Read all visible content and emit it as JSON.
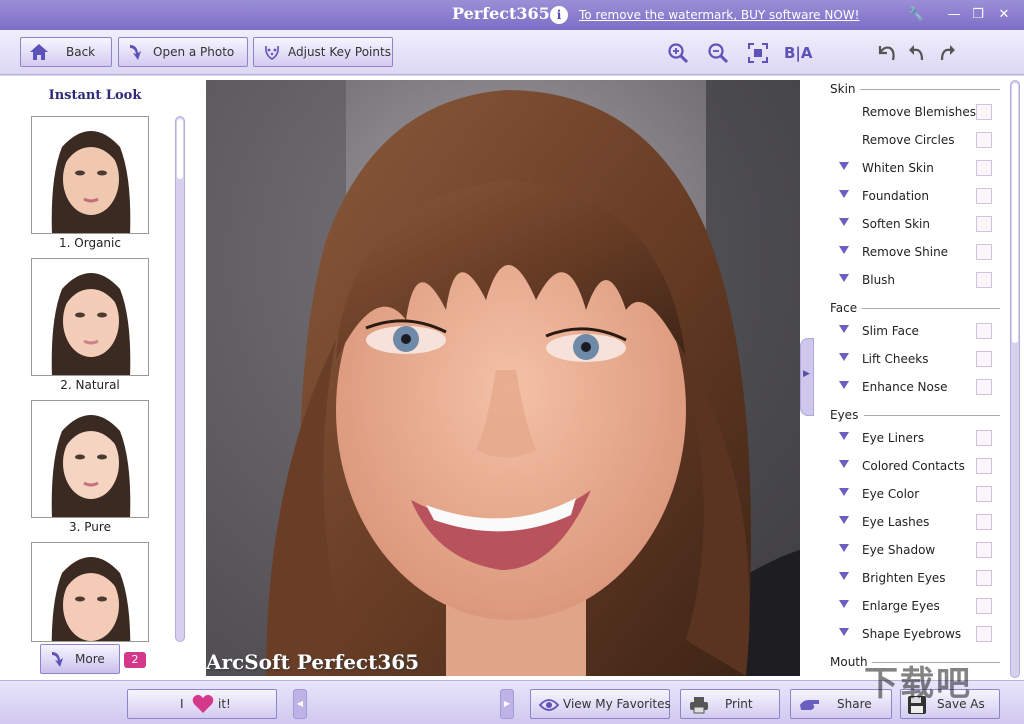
{
  "titlebar": {
    "app_title": "Perfect365",
    "info_glyph": "i",
    "watermark_link": "To remove the watermark, BUY software NOW!",
    "buttons": [
      {
        "name": "settings-icon",
        "glyph": "🔧"
      },
      {
        "name": "minimize-icon",
        "glyph": "—"
      },
      {
        "name": "restore-icon",
        "glyph": "❐"
      },
      {
        "name": "close-icon",
        "glyph": "✕"
      }
    ]
  },
  "toolbar": {
    "back_label": "Back",
    "open_photo_label": "Open a Photo",
    "adjust_key_points_label": "Adjust Key Points",
    "before_after_label": "B|A"
  },
  "instant_look": {
    "title": "Instant Look",
    "looks": [
      {
        "label": "1. Organic"
      },
      {
        "label": "2. Natural"
      },
      {
        "label": "3. Pure"
      },
      {
        "label": ""
      }
    ],
    "more_label": "More",
    "more_badge": "2"
  },
  "photo": {
    "watermark": "ArcSoft Perfect365"
  },
  "colors": {
    "accent": "#7d6ec7",
    "panel_bg": "#dcd6f0",
    "badge": "#d3388a",
    "arrow": "#6a5fc0"
  },
  "options": {
    "skin_head": "Skin",
    "skin": [
      {
        "label": "Remove Blemishes",
        "expandable": false
      },
      {
        "label": "Remove Circles",
        "expandable": false
      },
      {
        "label": "Whiten Skin",
        "expandable": true
      },
      {
        "label": "Foundation",
        "expandable": true
      },
      {
        "label": "Soften Skin",
        "expandable": true
      },
      {
        "label": "Remove Shine",
        "expandable": true
      },
      {
        "label": "Blush",
        "expandable": true
      }
    ],
    "face_head": "Face",
    "face": [
      {
        "label": "Slim Face",
        "expandable": true
      },
      {
        "label": "Lift Cheeks",
        "expandable": true
      },
      {
        "label": "Enhance Nose",
        "expandable": true
      }
    ],
    "eyes_head": "Eyes",
    "eyes": [
      {
        "label": "Eye Liners",
        "expandable": true
      },
      {
        "label": "Colored Contacts",
        "expandable": true
      },
      {
        "label": "Eye Color",
        "expandable": true
      },
      {
        "label": "Eye Lashes",
        "expandable": true
      },
      {
        "label": "Eye Shadow",
        "expandable": true
      },
      {
        "label": "Brighten Eyes",
        "expandable": true
      },
      {
        "label": "Enlarge Eyes",
        "expandable": true
      },
      {
        "label": "Shape Eyebrows",
        "expandable": true
      }
    ],
    "mouth_head": "Mouth"
  },
  "bottombar": {
    "love_prefix": "I",
    "love_suffix": "it!",
    "favorites_label": "View My Favorites",
    "print_label": "Print",
    "share_label": "Share",
    "save_as_label": "Save As"
  },
  "site_watermark": "下载吧"
}
